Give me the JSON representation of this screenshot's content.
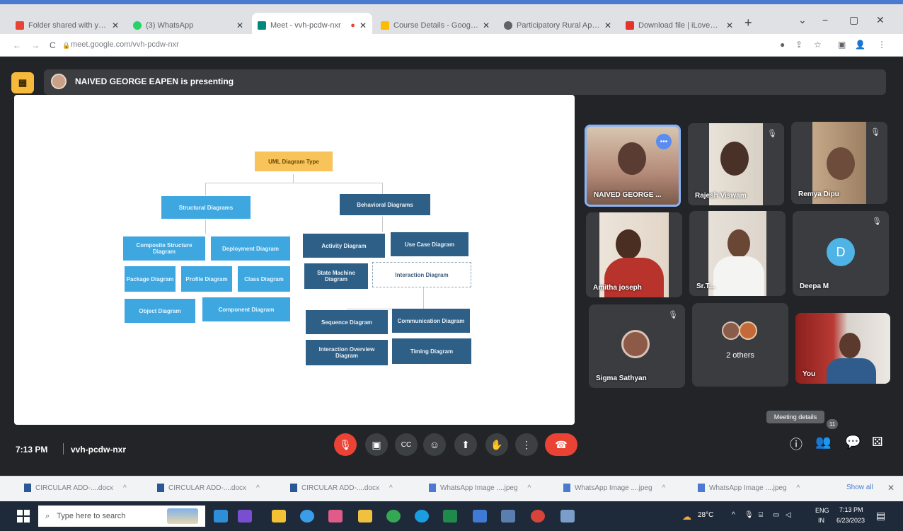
{
  "browser": {
    "tabs": [
      {
        "label": "Folder shared with you: \"Cu",
        "favicon": "gmail-icon",
        "color": "#ea4335"
      },
      {
        "label": "(3) WhatsApp",
        "favicon": "whatsapp-icon",
        "color": "#25d366"
      },
      {
        "label": "Meet - vvh-pcdw-nxr",
        "favicon": "meet-icon",
        "color": "#00897b",
        "recording": "●"
      },
      {
        "label": "Course Details - Google Dr",
        "favicon": "drive-icon",
        "color": "#fbbc04"
      },
      {
        "label": "Participatory Rural Apprai",
        "favicon": "globe-icon",
        "color": "#5f6368"
      },
      {
        "label": "Download file | iLovePDF",
        "favicon": "ilovepdf-icon",
        "color": "#e5322d"
      }
    ],
    "new_tab": "+",
    "window_controls": [
      "⌄",
      "−",
      "▢",
      "✕"
    ],
    "url": "meet.google.com/vvh-pcdw-nxr",
    "nav": {
      "back": "←",
      "forward": "→",
      "reload": "C"
    },
    "url_icons": [
      "●",
      "⇪",
      "☆",
      "▣",
      "👤",
      "⋮"
    ]
  },
  "meet": {
    "presenting_text": "NAIVED GEORGE EAPEN is presenting",
    "presenting_icon": "presentation-icon",
    "time": "7:13 PM",
    "meeting_code": "vvh-pcdw-nxr",
    "tooltip": "Meeting details",
    "participant_count": "11",
    "controls": [
      {
        "name": "mic-off-button",
        "glyph": "🎙",
        "red": true
      },
      {
        "name": "camera-button",
        "glyph": "▣"
      },
      {
        "name": "captions-button",
        "glyph": "CC"
      },
      {
        "name": "emoji-button",
        "glyph": "☺"
      },
      {
        "name": "present-button",
        "glyph": "⬆"
      },
      {
        "name": "raise-hand-button",
        "glyph": "✋"
      },
      {
        "name": "more-options-button",
        "glyph": "⋮"
      }
    ],
    "end_call_glyph": "☎",
    "right_controls": [
      {
        "name": "info-button",
        "glyph": "ⓘ"
      },
      {
        "name": "people-button",
        "glyph": "👥"
      },
      {
        "name": "chat-button",
        "glyph": "💬"
      },
      {
        "name": "activities-button",
        "glyph": "⚄"
      }
    ]
  },
  "diagram": {
    "root": "UML Diagram Type",
    "structural": "Structural Diagrams",
    "behavioral": "Behavioral Diagrams",
    "structural_children": [
      "Composite Structure Diagram",
      "Deployment Diagram",
      "Package Diagram",
      "Profile Diagram",
      "Class Diagram",
      "Object Diagram",
      "Component Diagram"
    ],
    "behavioral_children": [
      "Activity Diagram",
      "Use Case Diagram",
      "State Machine Diagram",
      "Interaction Diagram"
    ],
    "interaction_children": [
      "Sequence Diagram",
      "Communication Diagram",
      "Interaction Overview Diagram",
      "Timing Diagram"
    ]
  },
  "participants": [
    {
      "name": "NAIVED GEORGE ...",
      "more": "•••"
    },
    {
      "name": "Rajesh Viswam",
      "mic": "🎙"
    },
    {
      "name": "Remya Dipu",
      "mic": "🎙"
    },
    {
      "name": "Amitha joseph"
    },
    {
      "name": "Sr.T..."
    },
    {
      "name": "Deepa M",
      "initial": "D",
      "mic": "🎙"
    },
    {
      "name": "Sigma Sathyan",
      "mic": "🎙"
    },
    {
      "name": "2 others"
    },
    {
      "name": "You"
    }
  ],
  "downloads": [
    {
      "label": "CIRCULAR ADD-....docx",
      "type": "doc"
    },
    {
      "label": "CIRCULAR ADD-....docx",
      "type": "doc"
    },
    {
      "label": "CIRCULAR ADD-....docx",
      "type": "doc"
    },
    {
      "label": "WhatsApp Image ....jpeg",
      "type": "img"
    },
    {
      "label": "WhatsApp Image ....jpeg",
      "type": "img"
    },
    {
      "label": "WhatsApp Image ....jpeg",
      "type": "img"
    }
  ],
  "downloads_show_all": "Show all",
  "downloads_close": "✕",
  "taskbar": {
    "search_placeholder": "Type here to search",
    "weather": "28°C",
    "language": "ENG",
    "region": "IN",
    "clock_time": "7:13 PM",
    "clock_date": "6/23/2023",
    "apps": [
      {
        "name": "taskbar-app-vscode-icon",
        "color": "#2e8fd8"
      },
      {
        "name": "taskbar-app-visualstudio-icon",
        "color": "#7a4ed1"
      },
      {
        "name": "taskbar-app-sticky-icon",
        "color": "#f3c234"
      },
      {
        "name": "taskbar-app-edge-icon",
        "color": "#3a9de8"
      },
      {
        "name": "taskbar-app-paint-icon",
        "color": "#e05b8a"
      },
      {
        "name": "taskbar-app-files-icon",
        "color": "#f0c040"
      },
      {
        "name": "taskbar-app-chrome-icon",
        "color": "#34a853"
      },
      {
        "name": "taskbar-app-edge2-icon",
        "color": "#1b9de2"
      },
      {
        "name": "taskbar-app-excel-icon",
        "color": "#1f8a4c"
      },
      {
        "name": "taskbar-app-mail-icon",
        "color": "#3f7ad4"
      },
      {
        "name": "taskbar-app-calc-icon",
        "color": "#5a7fae"
      },
      {
        "name": "taskbar-app-chrome2-icon",
        "color": "#d9443a"
      },
      {
        "name": "taskbar-app-settings-icon",
        "color": "#7b9dc9"
      }
    ]
  }
}
